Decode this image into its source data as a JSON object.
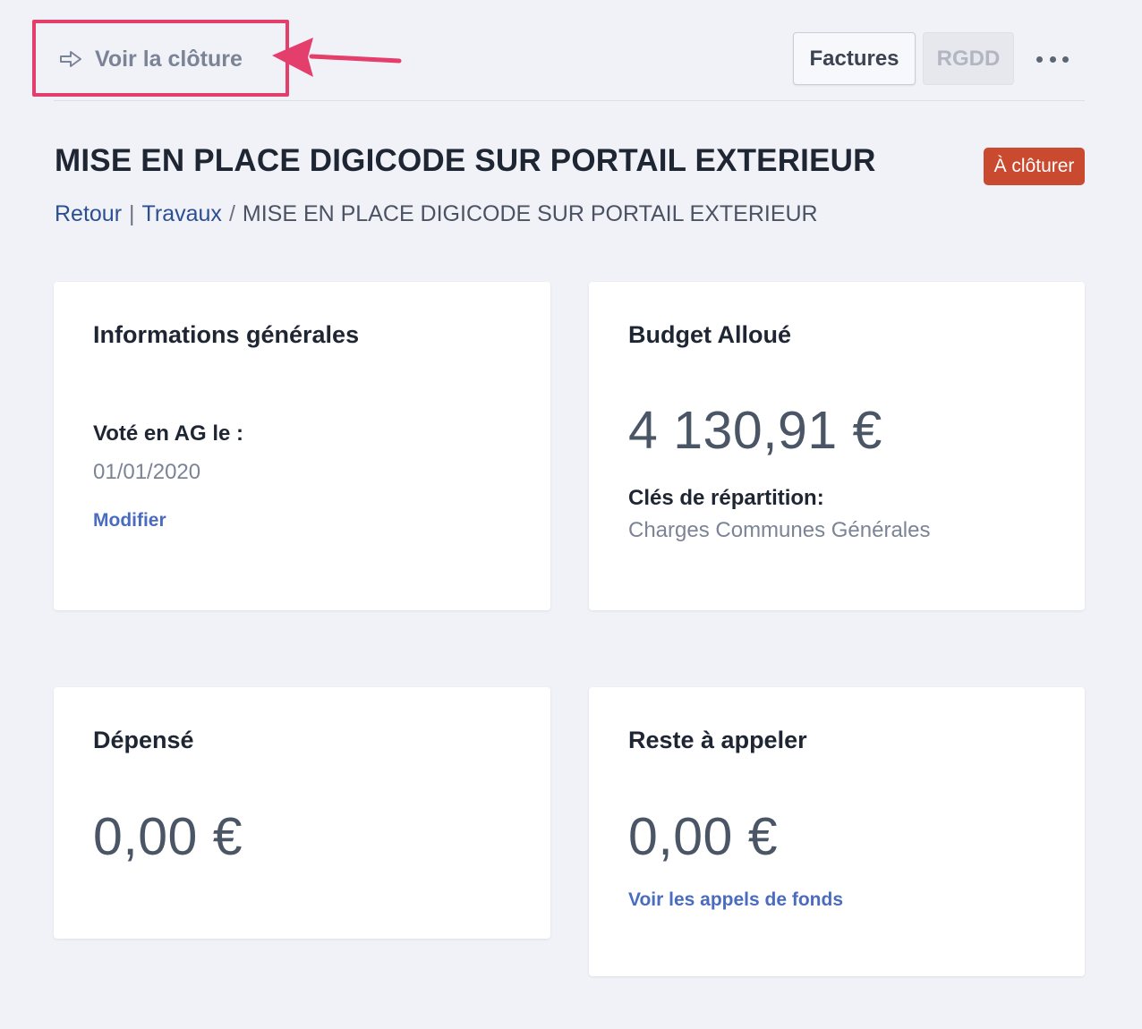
{
  "toolbar": {
    "voir_cloture": "Voir la clôture",
    "factures": "Factures",
    "rgdd": "RGDD"
  },
  "header": {
    "title": "MISE EN PLACE DIGICODE SUR PORTAIL EXTERIEUR",
    "status": "À clôturer",
    "breadcrumb": {
      "back": "Retour",
      "separator": "|",
      "section": "Travaux",
      "slash": "/",
      "current": "MISE EN PLACE DIGICODE SUR PORTAIL EXTERIEUR"
    }
  },
  "cards": {
    "infos": {
      "title": "Informations générales",
      "vote_label": "Voté en AG le :",
      "vote_date": "01/01/2020",
      "edit_link": "Modifier"
    },
    "budget": {
      "title": "Budget Alloué",
      "amount": "4 130,91 €",
      "keys_label": "Clés de répartition:",
      "keys_value": "Charges Communes Générales"
    },
    "depense": {
      "title": "Dépensé",
      "amount": "0,00 €"
    },
    "reste": {
      "title": "Reste à appeler",
      "amount": "0,00 €",
      "link": "Voir les appels de fonds"
    }
  },
  "colors": {
    "accent": "#e43e6c",
    "badge": "#c94a2e",
    "link": "#4a6cc0"
  }
}
